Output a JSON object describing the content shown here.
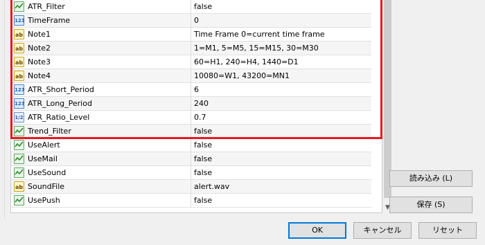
{
  "params": [
    {
      "name": "ATR_Filter",
      "value": "false",
      "type": "bool",
      "icon": "bool-icon"
    },
    {
      "name": "TimeFrame",
      "value": "0",
      "type": "int",
      "icon": "int-icon"
    },
    {
      "name": "Note1",
      "value": "Time Frame 0=current time frame",
      "type": "str",
      "icon": "string-icon"
    },
    {
      "name": "Note2",
      "value": "1=M1, 5=M5, 15=M15, 30=M30",
      "type": "str",
      "icon": "string-icon"
    },
    {
      "name": "Note3",
      "value": "60=H1, 240=H4, 1440=D1",
      "type": "str",
      "icon": "string-icon"
    },
    {
      "name": "Note4",
      "value": "10080=W1, 43200=MN1",
      "type": "str",
      "icon": "string-icon"
    },
    {
      "name": "ATR_Short_Period",
      "value": "6",
      "type": "int",
      "icon": "int-icon"
    },
    {
      "name": "ATR_Long_Period",
      "value": "240",
      "type": "int",
      "icon": "int-icon"
    },
    {
      "name": "ATR_Ratio_Level",
      "value": "0.7",
      "type": "dbl",
      "icon": "double-icon"
    },
    {
      "name": "Trend_Filter",
      "value": "false",
      "type": "bool",
      "icon": "bool-icon"
    },
    {
      "name": "UseAlert",
      "value": "false",
      "type": "bool",
      "icon": "bool-icon"
    },
    {
      "name": "UseMail",
      "value": "false",
      "type": "bool",
      "icon": "bool-icon"
    },
    {
      "name": "UseSound",
      "value": "false",
      "type": "bool",
      "icon": "bool-icon"
    },
    {
      "name": "SoundFile",
      "value": "alert.wav",
      "type": "str",
      "icon": "string-icon"
    },
    {
      "name": "UsePush",
      "value": "false",
      "type": "bool",
      "icon": "bool-icon"
    }
  ],
  "icon_glyphs": {
    "int": "123",
    "str": "ab",
    "dbl": "1/2",
    "bool": ""
  },
  "buttons": {
    "load": "読み込み (L)",
    "save": "保存 (S)",
    "ok": "OK",
    "cancel": "キャンセル",
    "reset": "リセット"
  },
  "colors": {
    "highlight": "#e8171f",
    "primary_border": "#0078d7"
  }
}
